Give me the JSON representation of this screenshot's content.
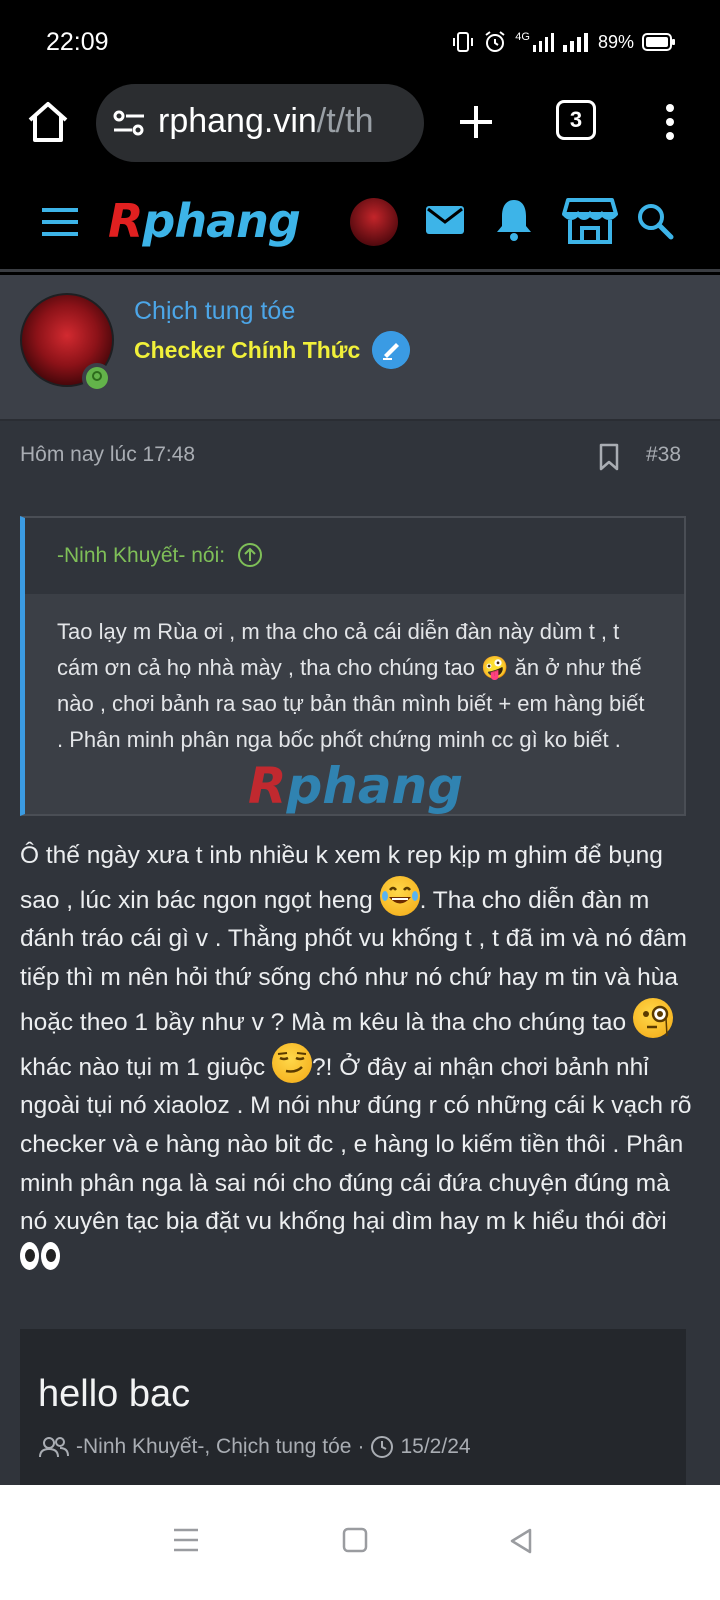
{
  "status_bar": {
    "time": "22:09",
    "network": "4G",
    "battery_percent": "89%"
  },
  "browser": {
    "url_host": "rphang.vin",
    "url_path": "/t/th",
    "tab_count": "3"
  },
  "site": {
    "logo_r": "R",
    "logo_rest": "phang"
  },
  "post": {
    "author_name": "Chịch tung tóe",
    "author_title": "Checker Chính Thức",
    "timestamp": "Hôm nay lúc 17:48",
    "post_number": "#38",
    "quote_author": "-Ninh Khuyết- nói:",
    "quote_text": "Tao lạy m Rùa ơi , m tha cho cả cái diễn đàn này dùm t , t cám ơn cả họ nhà mày , tha cho chúng tao 🤪 ăn ở như thế nào , chơi bảnh ra sao tự bản thân mình biết + em hàng biết . Phân minh phân nga bốc phốt chứng minh cc gì ko biết .",
    "body_1": "Ô thế ngày xưa t inb nhiều k xem k rep kịp m ghim để bụng sao , lúc xin bác ngon ngọt heng ",
    "body_2": ". Tha cho diễn đàn m đánh tráo cái gì v . Thằng phốt vu khống t , t đã im và nó đâm tiếp thì m nên hỏi thứ sống chó như nó chứ hay m tin và hùa hoặc theo 1 bầy như v ? Mà m kêu là tha cho chúng tao ",
    "body_3": " khác nào tụi m 1 giuộc ",
    "body_4": "?! Ở đây ai nhận chơi bảnh nhỉ ngoài tụi nó xiaoloz . M nói như đúng r có những cái k vạch rõ checker và e hàng nào bit đc , e hàng lo kiếm tiền thôi . Phân minh phân nga là sai nói cho đúng cái đứa chuyện đúng mà nó xuyên tạc bịa đặt vu khống hại dìm hay m k hiểu thói đời ",
    "emojis": [
      "laughing-tears",
      "monocle-face",
      "smirking-face",
      "eyes"
    ]
  },
  "thread_card": {
    "title": "hello bac",
    "participants": "-Ninh Khuyết-, Chịch tung tóe",
    "separator": "·",
    "date": "15/2/24"
  },
  "colors": {
    "link_blue": "#4ca6e8",
    "title_yellow": "#f1f03a",
    "quote_green": "#7fbf58",
    "logo_red": "#e02020",
    "logo_blue": "#3db4e8"
  }
}
